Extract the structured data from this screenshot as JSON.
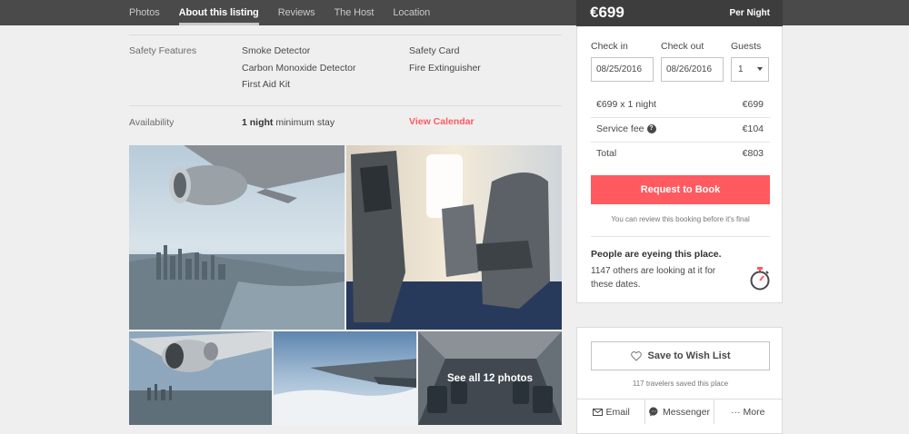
{
  "nav": {
    "tabs": [
      {
        "label": "Photos"
      },
      {
        "label": "About this listing"
      },
      {
        "label": "Reviews"
      },
      {
        "label": "The Host"
      },
      {
        "label": "Location"
      }
    ]
  },
  "safety": {
    "label": "Safety Features",
    "items": [
      "Smoke Detector",
      "Carbon Monoxide Detector",
      "First Aid Kit",
      "Safety Card",
      "Fire Extinguisher"
    ]
  },
  "availability": {
    "label": "Availability",
    "nights": "1 night",
    "min_stay": " minimum stay",
    "view_calendar": "View Calendar"
  },
  "photos": {
    "see_all": "See all 12 photos"
  },
  "booking": {
    "price": "€699",
    "per": "Per Night",
    "checkin_label": "Check in",
    "checkout_label": "Check out",
    "guests_label": "Guests",
    "checkin": "08/25/2016",
    "checkout": "08/26/2016",
    "guests": "1",
    "line_nights": "€699 x 1 night",
    "line_nights_amount": "€699",
    "service_fee_label": "Service fee",
    "service_fee_icon": "?",
    "service_fee_amount": "€104",
    "total_label": "Total",
    "total_amount": "€803",
    "request_button": "Request to Book",
    "review_note": "You can review this booking before it's final",
    "eyeing_title": "People are eyeing this place.",
    "eyeing_text": "1147 others are looking at it for these dates."
  },
  "wishlist": {
    "button": "Save to Wish List",
    "saved_note": "117 travelers saved this place",
    "share": [
      "Email",
      "Messenger",
      "··· More"
    ]
  },
  "colors": {
    "accent": "#ff5a5f",
    "nav_bg": "#4a4a4a",
    "price_bg": "#3d3d3d"
  }
}
